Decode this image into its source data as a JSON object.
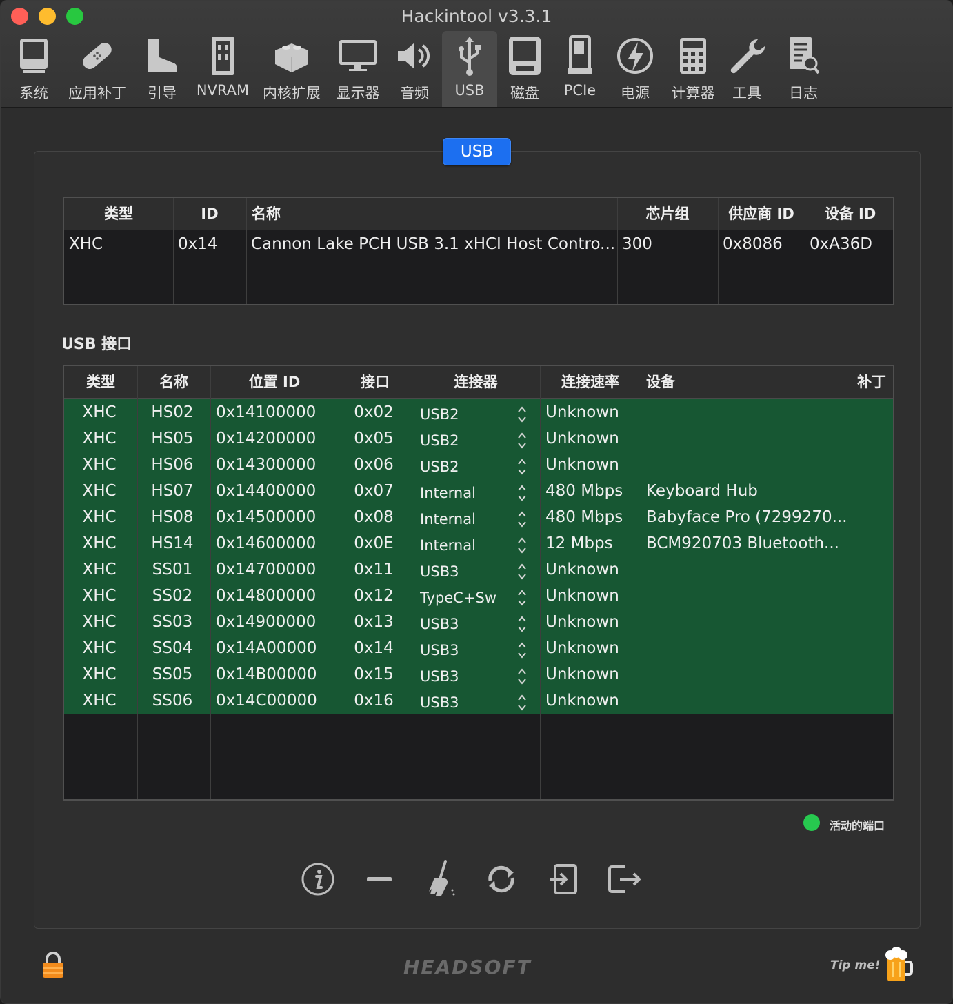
{
  "window": {
    "title": "Hackintool v3.3.1"
  },
  "toolbar": {
    "items": [
      {
        "label": "系统",
        "icon": "computer-icon"
      },
      {
        "label": "应用补丁",
        "icon": "bandage-icon"
      },
      {
        "label": "引导",
        "icon": "boot-icon"
      },
      {
        "label": "NVRAM",
        "icon": "memory-chip-icon"
      },
      {
        "label": "内核扩展",
        "icon": "lego-brick-icon"
      },
      {
        "label": "显示器",
        "icon": "monitor-icon"
      },
      {
        "label": "音频",
        "icon": "speaker-icon"
      },
      {
        "label": "USB",
        "icon": "usb-icon"
      },
      {
        "label": "磁盘",
        "icon": "disk-icon"
      },
      {
        "label": "PCIe",
        "icon": "pci-card-icon"
      },
      {
        "label": "电源",
        "icon": "power-bolt-icon"
      },
      {
        "label": "计算器",
        "icon": "calculator-icon"
      },
      {
        "label": "工具",
        "icon": "wrench-icon"
      },
      {
        "label": "日志",
        "icon": "log-document-icon"
      }
    ],
    "active": "USB"
  },
  "segment": {
    "label": "USB"
  },
  "controllers": {
    "headers": [
      "类型",
      "ID",
      "名称",
      "芯片组",
      "供应商 ID",
      "设备 ID"
    ],
    "rows": [
      [
        "XHC",
        "0x14",
        "Cannon Lake PCH USB 3.1 xHCI Host Contro...",
        "300",
        "0x8086",
        "0xA36D"
      ]
    ]
  },
  "ports": {
    "section_title": "USB 接口",
    "headers": [
      "类型",
      "名称",
      "位置 ID",
      "接口",
      "连接器",
      "连接速率",
      "设备",
      "补丁"
    ],
    "rows": [
      [
        "XHC",
        "HS02",
        "0x14100000",
        "0x02",
        "USB2",
        "Unknown",
        ""
      ],
      [
        "XHC",
        "HS05",
        "0x14200000",
        "0x05",
        "USB2",
        "Unknown",
        ""
      ],
      [
        "XHC",
        "HS06",
        "0x14300000",
        "0x06",
        "USB2",
        "Unknown",
        ""
      ],
      [
        "XHC",
        "HS07",
        "0x14400000",
        "0x07",
        "Internal",
        "480 Mbps",
        "Keyboard Hub"
      ],
      [
        "XHC",
        "HS08",
        "0x14500000",
        "0x08",
        "Internal",
        "480 Mbps",
        "Babyface Pro (7299270..."
      ],
      [
        "XHC",
        "HS14",
        "0x14600000",
        "0x0E",
        "Internal",
        "12 Mbps",
        "BCM920703 Bluetooth..."
      ],
      [
        "XHC",
        "SS01",
        "0x14700000",
        "0x11",
        "USB3",
        "Unknown",
        ""
      ],
      [
        "XHC",
        "SS02",
        "0x14800000",
        "0x12",
        "TypeC+Sw",
        "Unknown",
        ""
      ],
      [
        "XHC",
        "SS03",
        "0x14900000",
        "0x13",
        "USB3",
        "Unknown",
        ""
      ],
      [
        "XHC",
        "SS04",
        "0x14A00000",
        "0x14",
        "USB3",
        "Unknown",
        ""
      ],
      [
        "XHC",
        "SS05",
        "0x14B00000",
        "0x15",
        "USB3",
        "Unknown",
        ""
      ],
      [
        "XHC",
        "SS06",
        "0x14C00000",
        "0x16",
        "USB3",
        "Unknown",
        ""
      ]
    ],
    "row_color": "#175733"
  },
  "legend": {
    "label": "活动的端口",
    "color": "#27c94f"
  },
  "actions": [
    {
      "icon": "info-icon"
    },
    {
      "icon": "minus-icon"
    },
    {
      "icon": "broom-icon"
    },
    {
      "icon": "refresh-icon"
    },
    {
      "icon": "import-icon"
    },
    {
      "icon": "export-icon"
    }
  ],
  "footer": {
    "logo": "HEADSOFT",
    "tip": "Tip me!",
    "lock_icon": "lock-icon",
    "beer_icon": "beer-icon"
  }
}
